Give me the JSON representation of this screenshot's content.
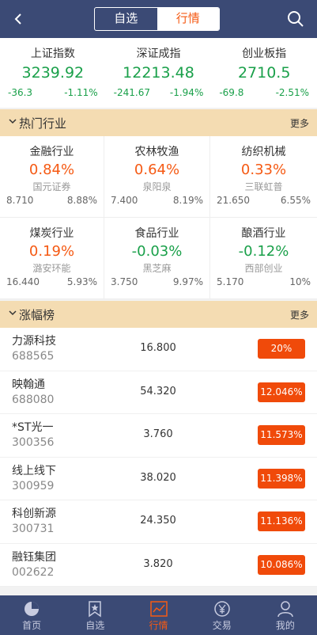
{
  "header": {
    "tabs": [
      {
        "label": "自选",
        "active": false
      },
      {
        "label": "行情",
        "active": true
      }
    ]
  },
  "indices": [
    {
      "name": "上证指数",
      "value": "3239.92",
      "change": "-36.3",
      "percent": "-1.11%"
    },
    {
      "name": "深证成指",
      "value": "12213.48",
      "change": "-241.67",
      "percent": "-1.94%"
    },
    {
      "name": "创业板指",
      "value": "2710.5",
      "change": "-69.8",
      "percent": "-2.51%"
    }
  ],
  "hot_sector": {
    "title": "热门行业",
    "more": "更多",
    "items": [
      {
        "name": "金融行业",
        "pct": "0.84%",
        "dir": "up",
        "leader": "国元证券",
        "price": "8.710",
        "leader_pct": "8.88%"
      },
      {
        "name": "农林牧渔",
        "pct": "0.64%",
        "dir": "up",
        "leader": "泉阳泉",
        "price": "7.400",
        "leader_pct": "8.19%"
      },
      {
        "name": "纺织机械",
        "pct": "0.33%",
        "dir": "up",
        "leader": "三联虹普",
        "price": "21.650",
        "leader_pct": "6.55%"
      },
      {
        "name": "煤炭行业",
        "pct": "0.19%",
        "dir": "up",
        "leader": "潞安环能",
        "price": "16.440",
        "leader_pct": "5.93%"
      },
      {
        "name": "食品行业",
        "pct": "-0.03%",
        "dir": "down",
        "leader": "黑芝麻",
        "price": "3.750",
        "leader_pct": "9.97%"
      },
      {
        "name": "酿酒行业",
        "pct": "-0.12%",
        "dir": "down",
        "leader": "西部创业",
        "price": "5.170",
        "leader_pct": "10%"
      }
    ]
  },
  "gainers": {
    "title": "涨幅榜",
    "more": "更多",
    "rows": [
      {
        "name": "力源科技",
        "code": "688565",
        "price": "16.800",
        "pct": "20%"
      },
      {
        "name": "映翰通",
        "code": "688080",
        "price": "54.320",
        "pct": "12.046%"
      },
      {
        "name": "*ST光一",
        "code": "300356",
        "price": "3.760",
        "pct": "11.573%"
      },
      {
        "name": "线上线下",
        "code": "300959",
        "price": "38.020",
        "pct": "11.398%"
      },
      {
        "name": "科创新源",
        "code": "300731",
        "price": "24.350",
        "pct": "11.136%"
      },
      {
        "name": "融钰集团",
        "code": "002622",
        "price": "3.820",
        "pct": "10.086%"
      }
    ]
  },
  "tabbar": [
    {
      "label": "首页",
      "icon": "home-pie-icon"
    },
    {
      "label": "自选",
      "icon": "watchlist-star-icon"
    },
    {
      "label": "行情",
      "icon": "market-chart-icon",
      "active": true
    },
    {
      "label": "交易",
      "icon": "yen-trade-icon"
    },
    {
      "label": "我的",
      "icon": "user-icon"
    }
  ],
  "colors": {
    "nav": "#3b4a75",
    "accent": "#f55a14",
    "up": "#f55a14",
    "down": "#1aa04a",
    "section": "#f4dcb2"
  }
}
